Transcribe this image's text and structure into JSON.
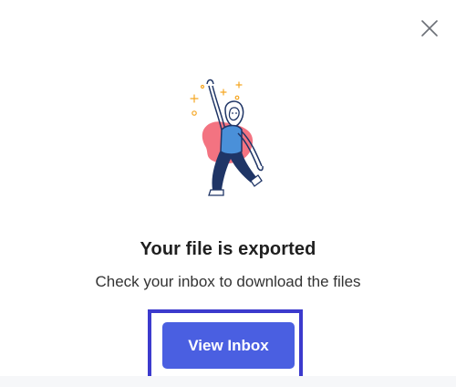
{
  "dialog": {
    "title": "Your file is exported",
    "subtitle": "Check your inbox to download the files",
    "primary_button_label": "View Inbox"
  },
  "icons": {
    "close": "close-icon",
    "illustration": "celebrating-person-illustration"
  },
  "colors": {
    "primary": "#4a5fe1",
    "focus_ring": "#3c3acd",
    "title_text": "#1f1f1f",
    "body_text": "#333333",
    "illustration_accent": "#f26b7a",
    "illustration_shirt": "#4a90d9",
    "illustration_pants": "#1f3566",
    "sparkles": "#f5a623"
  }
}
